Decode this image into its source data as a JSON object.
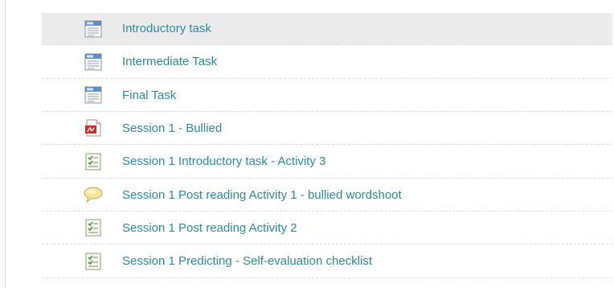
{
  "activities": [
    {
      "label": "Introductory task",
      "icon": "assignment-icon",
      "highlighted": true
    },
    {
      "label": "Intermediate Task",
      "icon": "assignment-icon"
    },
    {
      "label": "Final Task",
      "icon": "assignment-icon"
    },
    {
      "label": "Session 1 - Bullied",
      "icon": "pdf-file-icon"
    },
    {
      "label": "Session 1 Introductory task - Activity 3",
      "icon": "checklist-icon"
    },
    {
      "label": "Session 1 Post reading Activity 1 - bullied wordshoot",
      "icon": "chat-bubble-icon"
    },
    {
      "label": "Session 1 Post reading Activity 2",
      "icon": "checklist-icon"
    },
    {
      "label": "Session 1 Predicting - Self-evaluation checklist",
      "icon": "checklist-icon"
    }
  ],
  "colors": {
    "link": "#2a8ca0",
    "highlight_row": "#ebebeb",
    "divider": "#dcdcdc"
  }
}
